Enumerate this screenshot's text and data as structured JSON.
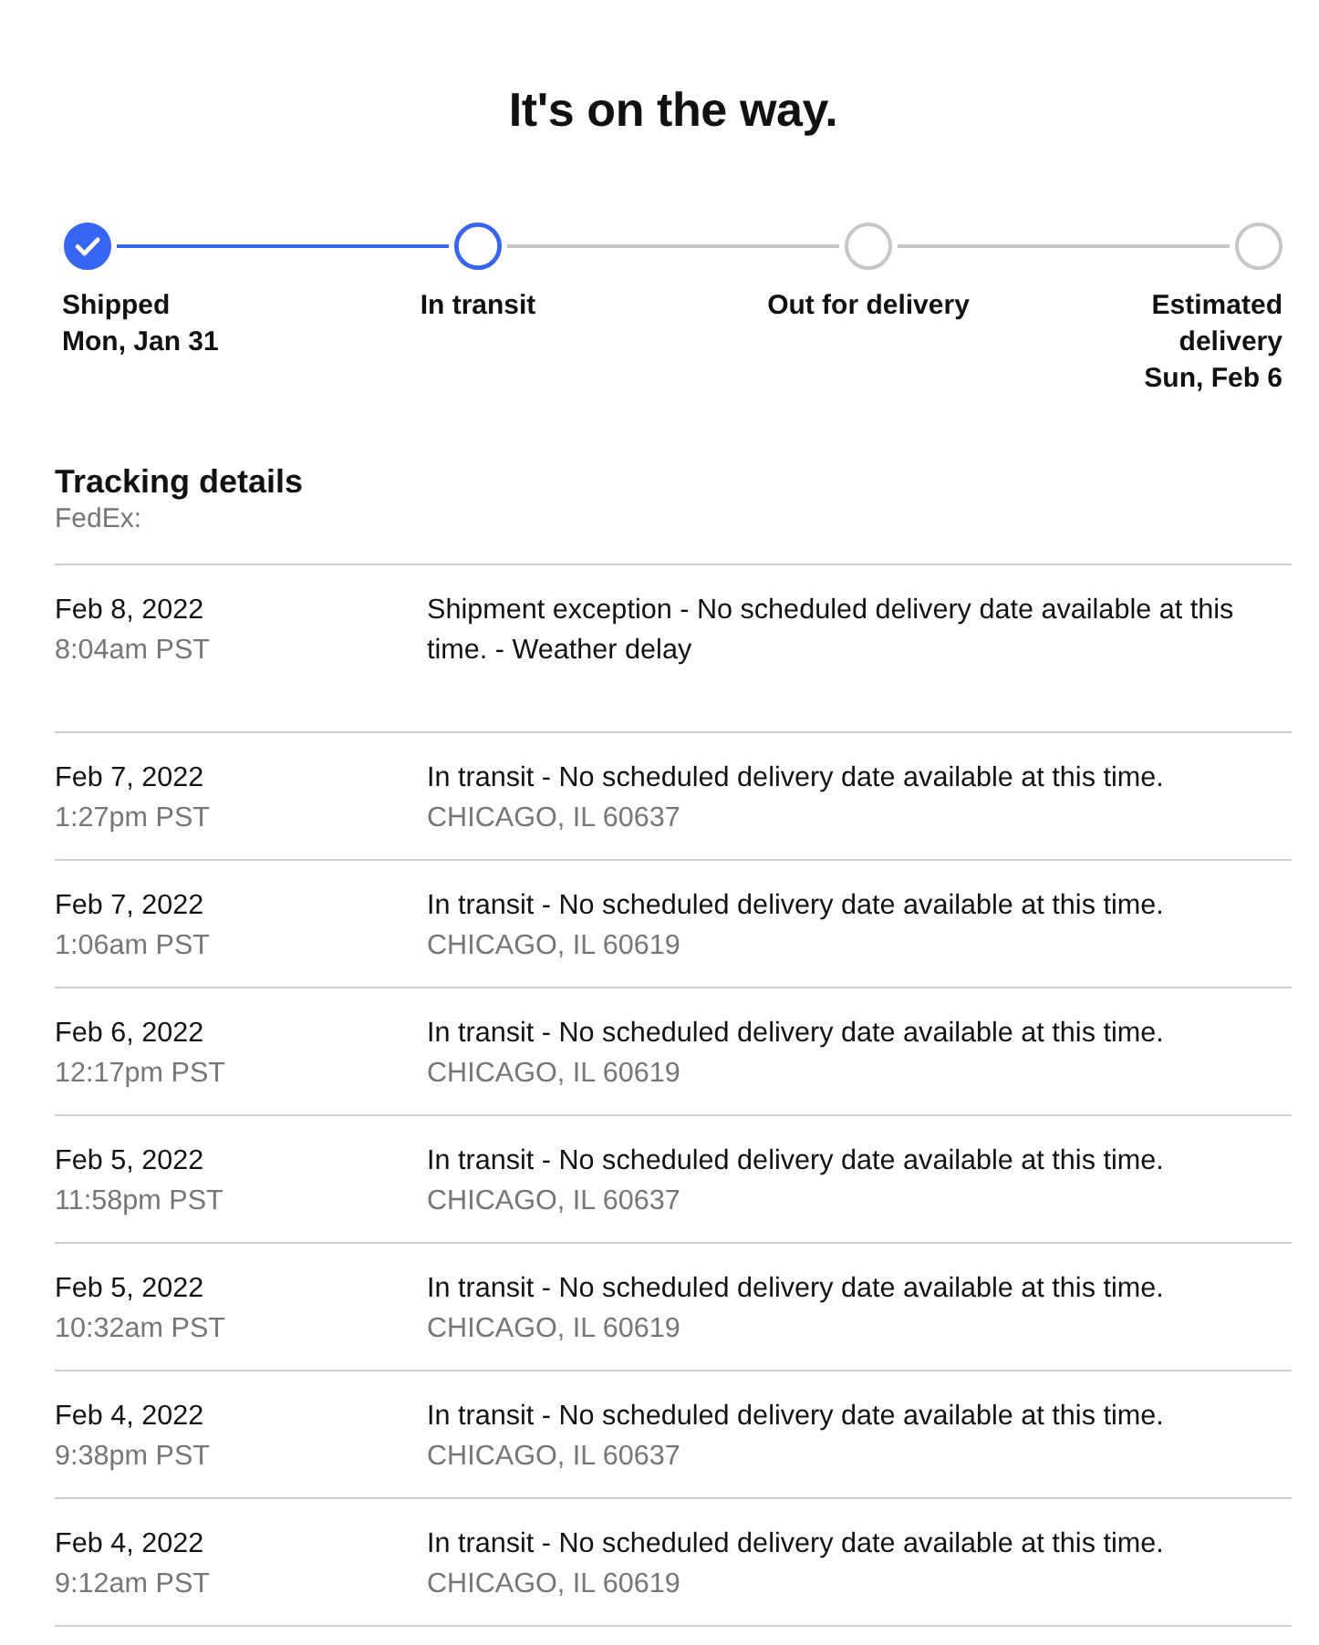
{
  "title": "It's on the way.",
  "progress": {
    "steps": [
      {
        "label": "Shipped",
        "date": "Mon, Jan 31",
        "completed": true,
        "current": false
      },
      {
        "label": "In transit",
        "completed": false,
        "current": true
      },
      {
        "label": "Out for delivery",
        "completed": false,
        "current": false
      },
      {
        "label": "Estimated delivery",
        "date": "Sun, Feb 6",
        "completed": false,
        "current": false
      }
    ]
  },
  "tracking": {
    "heading": "Tracking details",
    "carrier": "FedEx:",
    "events": [
      {
        "date": "Feb 8, 2022",
        "time": "8:04am PST",
        "description": "Shipment exception - No scheduled delivery date available at this time. - Weather delay"
      },
      {
        "date": "Feb 7, 2022",
        "time": "1:27pm PST",
        "description": "In transit - No scheduled delivery date available at this time.",
        "location": "CHICAGO, IL 60637"
      },
      {
        "date": "Feb 7, 2022",
        "time": "1:06am PST",
        "description": "In transit - No scheduled delivery date available at this time.",
        "location": "CHICAGO, IL 60619"
      },
      {
        "date": "Feb 6, 2022",
        "time": "12:17pm PST",
        "description": "In transit - No scheduled delivery date available at this time.",
        "location": "CHICAGO, IL 60619"
      },
      {
        "date": "Feb 5, 2022",
        "time": "11:58pm PST",
        "description": "In transit - No scheduled delivery date available at this time.",
        "location": "CHICAGO, IL 60637"
      },
      {
        "date": "Feb 5, 2022",
        "time": "10:32am PST",
        "description": "In transit - No scheduled delivery date available at this time.",
        "location": "CHICAGO, IL 60619"
      },
      {
        "date": "Feb 4, 2022",
        "time": "9:38pm PST",
        "description": "In transit - No scheduled delivery date available at this time.",
        "location": "CHICAGO, IL 60637"
      },
      {
        "date": "Feb 4, 2022",
        "time": "9:12am PST",
        "description": "In transit - No scheduled delivery date available at this time.",
        "location": "CHICAGO, IL 60619"
      }
    ]
  }
}
